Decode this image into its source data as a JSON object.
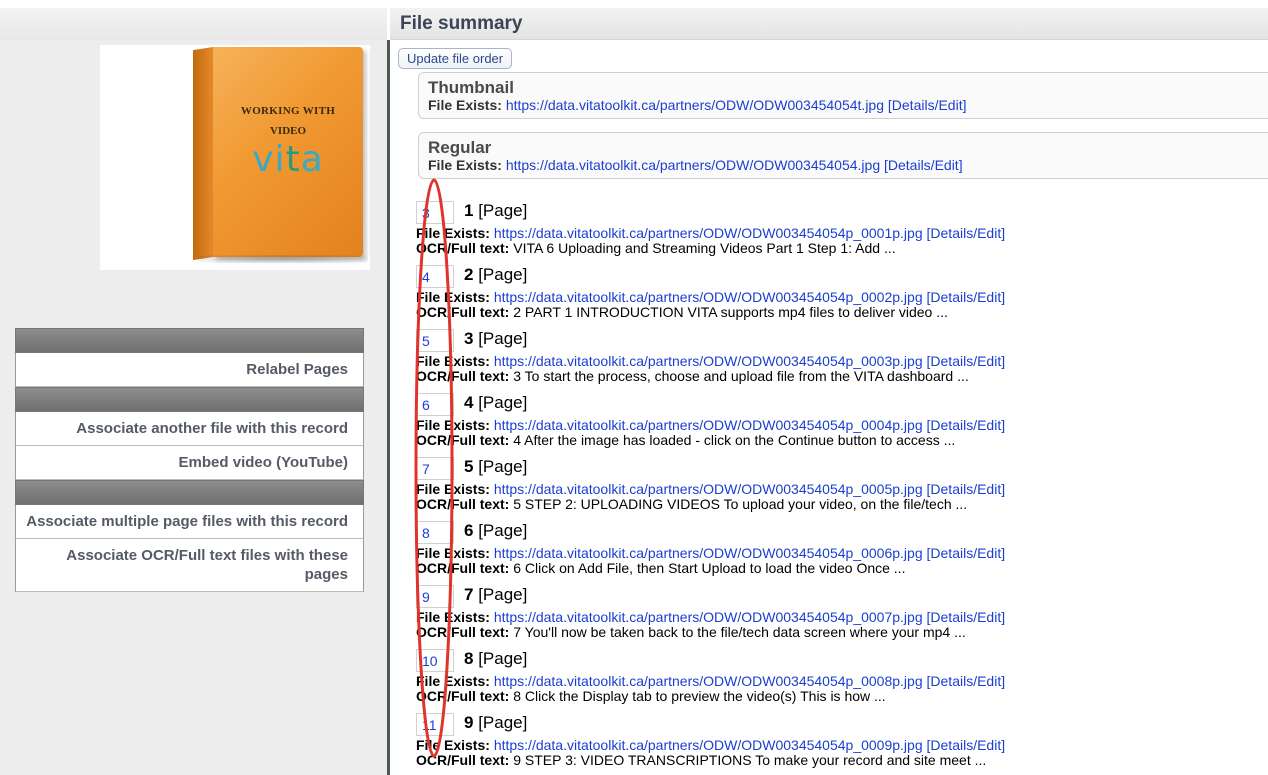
{
  "header": {
    "title": "File summary"
  },
  "book": {
    "line1": "WORKING WITH",
    "line2": "VIDEO",
    "brand_vi": "vi",
    "brand_t": "t",
    "brand_a": "a"
  },
  "sidebar": {
    "items": [
      {
        "label": "Relabel Pages"
      },
      {
        "label": "Associate another file with this record"
      },
      {
        "label": "Embed video (YouTube)"
      },
      {
        "label": "Associate multiple page files with this record"
      },
      {
        "label": "Associate OCR/Full text files with these pages"
      }
    ]
  },
  "main": {
    "update_button": "Update file order",
    "file_exists_label": "File Exists:",
    "ocr_label": "OCR/Full text:",
    "details_link": "[Details/Edit]",
    "thumbnail": {
      "title": "Thumbnail",
      "url": "https://data.vitatoolkit.ca/partners/ODW/ODW003454054t.jpg"
    },
    "regular": {
      "title": "Regular",
      "url": "https://data.vitatoolkit.ca/partners/ODW/ODW003454054.jpg"
    },
    "pages": [
      {
        "order": "3",
        "num": "1",
        "tag": "[Page]",
        "url": "https://data.vitatoolkit.ca/partners/ODW/ODW003454054p_0001p.jpg",
        "ocr": "VITA 6 Uploading and Streaming Videos Part 1 Step 1: Add ..."
      },
      {
        "order": "4",
        "num": "2",
        "tag": "[Page]",
        "url": "https://data.vitatoolkit.ca/partners/ODW/ODW003454054p_0002p.jpg",
        "ocr": "2 PART 1 INTRODUCTION VITA supports mp4 files to deliver video ..."
      },
      {
        "order": "5",
        "num": "3",
        "tag": "[Page]",
        "url": "https://data.vitatoolkit.ca/partners/ODW/ODW003454054p_0003p.jpg",
        "ocr": "3 To start the process, choose and upload file from the VITA dashboard ..."
      },
      {
        "order": "6",
        "num": "4",
        "tag": "[Page]",
        "url": "https://data.vitatoolkit.ca/partners/ODW/ODW003454054p_0004p.jpg",
        "ocr": "4 After the image has loaded - click on the Continue button to access ..."
      },
      {
        "order": "7",
        "num": "5",
        "tag": "[Page]",
        "url": "https://data.vitatoolkit.ca/partners/ODW/ODW003454054p_0005p.jpg",
        "ocr": "5 STEP 2: UPLOADING VIDEOS To upload your video, on the file/tech ..."
      },
      {
        "order": "8",
        "num": "6",
        "tag": "[Page]",
        "url": "https://data.vitatoolkit.ca/partners/ODW/ODW003454054p_0006p.jpg",
        "ocr": "6 Click on Add File, then Start Upload to load the video Once ..."
      },
      {
        "order": "9",
        "num": "7",
        "tag": "[Page]",
        "url": "https://data.vitatoolkit.ca/partners/ODW/ODW003454054p_0007p.jpg",
        "ocr": "7 You'll now be taken back to the file/tech data screen where your mp4 ..."
      },
      {
        "order": "10",
        "num": "8",
        "tag": "[Page]",
        "url": "https://data.vitatoolkit.ca/partners/ODW/ODW003454054p_0008p.jpg",
        "ocr": "8 Click the Display tab to preview the video(s) This is how ..."
      },
      {
        "order": "11",
        "num": "9",
        "tag": "[Page]",
        "url": "https://data.vitatoolkit.ca/partners/ODW/ODW003454054p_0009p.jpg",
        "ocr": "9 STEP 3: VIDEO TRANSCRIPTIONS To make your record and site meet ..."
      }
    ]
  },
  "annotation": {
    "ellipse_color": "#e0332b"
  }
}
